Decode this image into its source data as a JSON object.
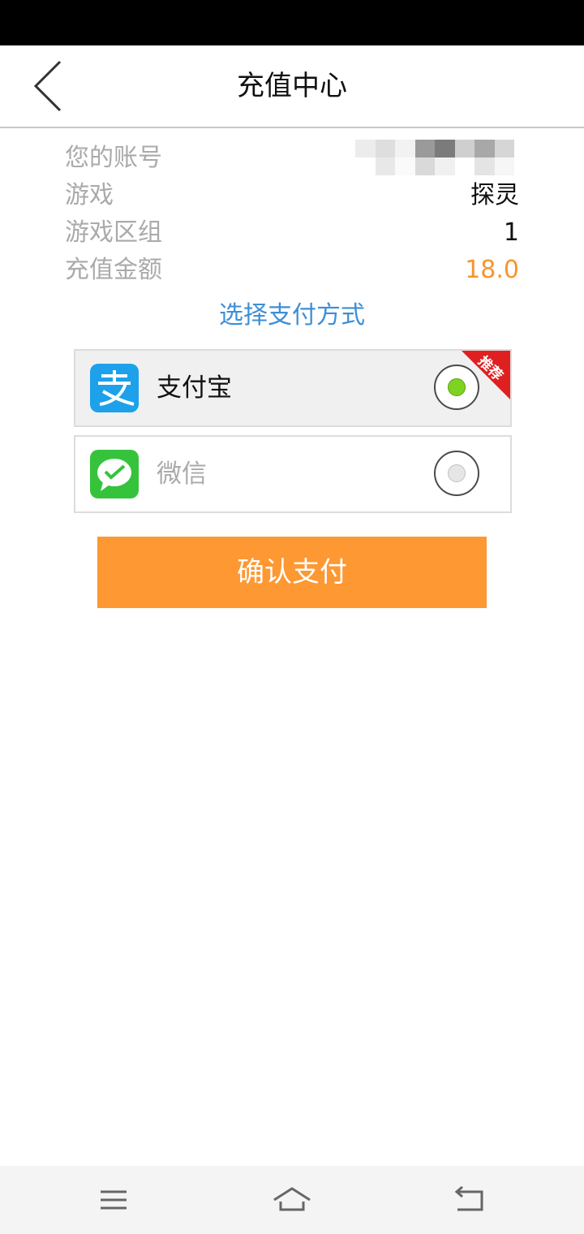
{
  "header": {
    "title": "充值中心"
  },
  "order_info": {
    "rows": [
      {
        "label": "您的账号",
        "value": ""
      },
      {
        "label": "游戏",
        "value": "探灵"
      },
      {
        "label": "游戏区组",
        "value": "1"
      },
      {
        "label": "充值金额",
        "value": "18.0"
      }
    ]
  },
  "payment": {
    "section_title": "选择支付方式",
    "methods": [
      {
        "label": "支付宝",
        "selected": true,
        "badge": "推荐"
      },
      {
        "label": "微信",
        "selected": false,
        "badge": ""
      }
    ]
  },
  "confirm_label": "确认支付",
  "colors": {
    "accent_orange": "#fd9832",
    "amount_orange": "#f6952e",
    "link_blue": "#3d8fd6",
    "alipay_blue": "#1ca1ea",
    "wechat_green": "#36c33c",
    "radio_selected_green": "#7ed321",
    "badge_red": "#e02020"
  },
  "icons": {
    "back": "chevron-left-icon",
    "alipay": "alipay-icon",
    "wechat": "wechat-pay-icon",
    "nav_menu": "menu-icon",
    "nav_home": "home-icon",
    "nav_back": "back-arrow-icon"
  }
}
